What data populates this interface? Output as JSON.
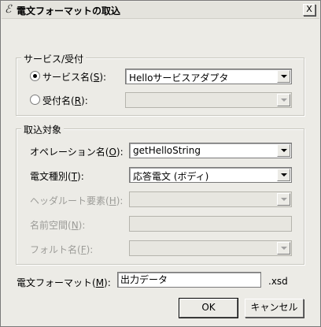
{
  "window": {
    "title": "電文フォーマットの取込",
    "close_label": "X"
  },
  "service_group": {
    "legend": "サービス/受付",
    "service_radio": {
      "label_prefix": "サービス名(",
      "accesskey": "S",
      "label_suffix": "):",
      "checked": true
    },
    "service_select": {
      "value": "Helloサービスアダプタ"
    },
    "reception_radio": {
      "label_prefix": "受付名(",
      "accesskey": "R",
      "label_suffix": "):",
      "checked": false
    },
    "reception_select": {
      "value": ""
    }
  },
  "target_group": {
    "legend": "取込対象",
    "operation": {
      "label_prefix": "オペレーション名(",
      "accesskey": "O",
      "label_suffix": "):",
      "value": "getHelloString"
    },
    "message_type": {
      "label_prefix": "電文種別(",
      "accesskey": "T",
      "label_suffix": "):",
      "value": "応答電文 (ボディ)"
    },
    "header_root": {
      "label_prefix": "ヘッダルート要素(",
      "accesskey": "H",
      "label_suffix": "):",
      "value": ""
    },
    "namespace": {
      "label_prefix": "名前空間(",
      "accesskey": "N",
      "label_suffix": "):",
      "value": ""
    },
    "fault_name": {
      "label_prefix": "フォルト名(",
      "accesskey": "F",
      "label_suffix": "):",
      "value": ""
    }
  },
  "format": {
    "label_prefix": "電文フォーマット(",
    "accesskey": "M",
    "label_suffix": "):",
    "value": "出力データ",
    "extension": ".xsd"
  },
  "buttons": {
    "ok_label": "OK",
    "cancel_label": "キャンセル"
  }
}
